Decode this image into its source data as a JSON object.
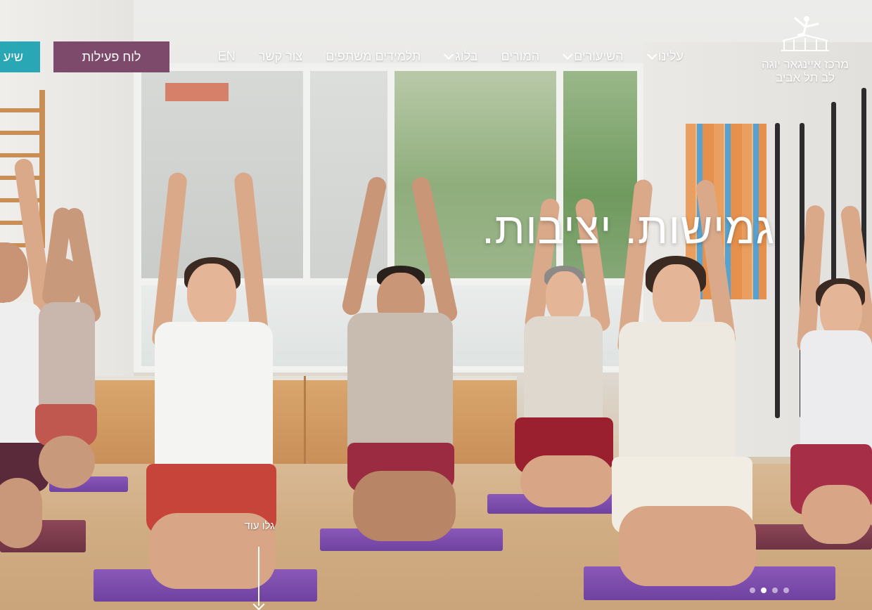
{
  "site": {
    "logo_line1": "מרכז איינגאר יוגה",
    "logo_line2": "לב תל אביב"
  },
  "nav": {
    "items": [
      {
        "label": "עלינו",
        "has_dropdown": true
      },
      {
        "label": "השיעורים",
        "has_dropdown": true
      },
      {
        "label": "המורים",
        "has_dropdown": false
      },
      {
        "label": "בלוג",
        "has_dropdown": true
      },
      {
        "label": "תלמידים משתפים",
        "has_dropdown": false
      },
      {
        "label": "צור קשר",
        "has_dropdown": false
      },
      {
        "label": "EN",
        "has_dropdown": false
      }
    ],
    "activity_button": "לוח פעילות",
    "teal_button": "שיע"
  },
  "hero": {
    "title": "גמישות. יציבות.",
    "scroll_label": "גלו עוד",
    "slides_total": 4,
    "active_slide": 2
  },
  "colors": {
    "activity_button_bg": "#7d4a6c",
    "teal_button_bg": "#2aa7b4",
    "text_on_dark": "#ffffff",
    "mat_purple": "#7a4cae",
    "shorts_red": "#c7443a",
    "shorts_maroon": "#8a2b3c"
  },
  "icons": {
    "logo": "yoga-pose-pavilion-logo",
    "dropdown": "chevron-down-icon",
    "scroll": "arrow-down-icon"
  }
}
